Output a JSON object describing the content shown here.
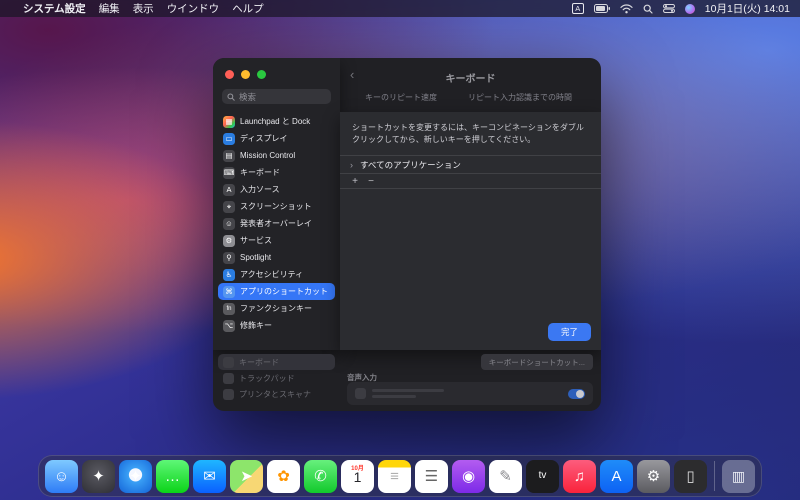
{
  "colors": {
    "accent_blue": "#3b78f2",
    "selection_blue": "#3576f6",
    "traffic_red": "#ff5f57",
    "traffic_yellow": "#febc2e",
    "traffic_green": "#2ac840"
  },
  "menu_bar": {
    "apple_menu": "",
    "items": [
      "システム設定",
      "編集",
      "表示",
      "ウインドウ",
      "ヘルプ"
    ],
    "status": {
      "input_badge": "A",
      "icons": [
        "input-source-icon",
        "battery-icon",
        "wifi-icon",
        "search-icon",
        "control-center-icon",
        "siri-icon"
      ],
      "datetime": "10月1日(火) 14:01"
    }
  },
  "settings_window": {
    "behind": {
      "back_chevron": "‹",
      "title": "キーボード",
      "column_labels": [
        "キーのリピート速度",
        "リピート入力認識までの時間"
      ],
      "sidebar_items": [
        {
          "label": "キーボード",
          "selected": true
        },
        {
          "label": "トラックパッド",
          "selected": false
        },
        {
          "label": "プリンタとスキャナ",
          "selected": false
        }
      ],
      "shortcuts_button": "キーボードショートカット...",
      "voice_section": "音声入力"
    },
    "sheet": {
      "search_placeholder": "検索",
      "sidebar": {
        "selected_index": 10,
        "items": [
          {
            "id": "launchpad-dock",
            "label": "Launchpad と Dock",
            "icon": "launchpad-icon",
            "glyph": "▦",
            "color": "linear-gradient(135deg,#ffb340,#ff5f52 45%,#30c84b 75%,#32ade6)"
          },
          {
            "id": "display",
            "label": "ディスプレイ",
            "icon": "display-icon",
            "glyph": "▭",
            "color": "#2a7de1"
          },
          {
            "id": "mission-control",
            "label": "Mission Control",
            "icon": "mission-control-icon",
            "glyph": "▤",
            "color": "#45454a"
          },
          {
            "id": "keyboard",
            "label": "キーボード",
            "icon": "keyboard-icon",
            "glyph": "⌨",
            "color": "#45454a"
          },
          {
            "id": "input-sources",
            "label": "入力ソース",
            "icon": "input-sources-icon",
            "glyph": "A",
            "color": "#45454a"
          },
          {
            "id": "screenshots",
            "label": "スクリーンショット",
            "icon": "screenshot-icon",
            "glyph": "⌖",
            "color": "#45454a"
          },
          {
            "id": "presenter-overlay",
            "label": "発表者オーバーレイ",
            "icon": "presenter-overlay-icon",
            "glyph": "☺",
            "color": "#45454a"
          },
          {
            "id": "services",
            "label": "サービス",
            "icon": "services-gear-icon",
            "glyph": "⚙",
            "color": "#8e8e93"
          },
          {
            "id": "spotlight",
            "label": "Spotlight",
            "icon": "spotlight-icon",
            "glyph": "⚲",
            "color": "#45454a"
          },
          {
            "id": "accessibility",
            "label": "アクセシビリティ",
            "icon": "accessibility-icon",
            "glyph": "♿",
            "color": "#2a7de1"
          },
          {
            "id": "app-shortcuts",
            "label": "アプリのショートカット",
            "icon": "app-shortcuts-icon",
            "glyph": "⌘",
            "color": "#5596f0"
          },
          {
            "id": "function-keys",
            "label": "ファンクションキー",
            "icon": "function-keys-icon",
            "glyph": "fn",
            "color": "#5a5a5e"
          },
          {
            "id": "modifier-keys",
            "label": "修飾キー",
            "icon": "modifier-keys-icon",
            "glyph": "⌥",
            "color": "#5a5a5e"
          }
        ]
      },
      "instruction": "ショートカットを変更するには、キーコンビネーションをダブルクリックしてから、新しいキーを押してください。",
      "rows": [
        {
          "disclosure": "›",
          "label": "すべてのアプリケーション"
        }
      ],
      "add_button": "+",
      "remove_button": "−",
      "done_button": "完了"
    }
  },
  "dock": {
    "apps": [
      {
        "id": "finder",
        "label": "Finder",
        "glyph": "☺",
        "bg": "linear-gradient(180deg,#7ec9ff,#2e7cf6)"
      },
      {
        "id": "launchpad",
        "label": "Launchpad",
        "glyph": "✦",
        "bg": "radial-gradient(circle at 50% 40%,#5a5a62,#2f2f35)"
      },
      {
        "id": "safari",
        "label": "Safari",
        "glyph": "✦",
        "bg": "radial-gradient(circle at 50% 45%,#f4f7ff 0 26%,#3aa0f5 28%,#1464d8)"
      },
      {
        "id": "messages",
        "label": "メッセージ",
        "glyph": "…",
        "bg": "linear-gradient(180deg,#5ef777,#0bd318)"
      },
      {
        "id": "mail",
        "label": "メール",
        "glyph": "✉",
        "bg": "linear-gradient(180deg,#1fb6ff,#0a60ff)"
      },
      {
        "id": "maps",
        "label": "マップ",
        "glyph": "➤",
        "bg": "linear-gradient(135deg,#8de56b 55%,#f7d774 55%)"
      },
      {
        "id": "photos",
        "label": "写真",
        "glyph": "✿",
        "fg": "#ff9500",
        "bg": "#ffffff"
      },
      {
        "id": "facetime",
        "label": "FaceTime",
        "glyph": "✆",
        "bg": "linear-gradient(180deg,#67f07d,#12c92c)"
      },
      {
        "id": "calendar",
        "label": "カレンダー",
        "top": "10月",
        "day": "1",
        "bg": "#ffffff"
      },
      {
        "id": "notes",
        "label": "メモ",
        "glyph": "≡",
        "fg": "#b0b0b0",
        "bg": "linear-gradient(180deg,#ffd60a 0 22%,#ffffff 22%)"
      },
      {
        "id": "reminders",
        "label": "リマインダー",
        "glyph": "☰",
        "fg": "#666666",
        "bg": "#ffffff"
      },
      {
        "id": "podcasts",
        "label": "ポッドキャスト",
        "glyph": "◉",
        "bg": "linear-gradient(180deg,#b35cf0,#7d2ae8)"
      },
      {
        "id": "freeform",
        "label": "フリーボード",
        "glyph": "✎",
        "fg": "#8a8a8e",
        "bg": "#ffffff"
      },
      {
        "id": "tv",
        "label": "TV",
        "glyph": "tv",
        "fs": "10px",
        "bg": "#1c1c1e"
      },
      {
        "id": "music",
        "label": "ミュージック",
        "glyph": "♫",
        "bg": "linear-gradient(180deg,#fc5c7d,#fa233b)"
      },
      {
        "id": "appstore",
        "label": "App Store",
        "glyph": "A",
        "bg": "linear-gradient(180deg,#1f8cf9,#0d62f4)"
      },
      {
        "id": "settings",
        "label": "システム設定",
        "glyph": "⚙",
        "bg": "linear-gradient(180deg,#98989d,#5b5b60)"
      },
      {
        "id": "iphone-mirroring",
        "label": "iPhoneミラーリング",
        "glyph": "▯",
        "fg": "#dddddd",
        "bg": "#2c2c2e"
      }
    ],
    "trash": {
      "id": "trash",
      "label": "ゴミ箱",
      "glyph": "▥"
    }
  }
}
